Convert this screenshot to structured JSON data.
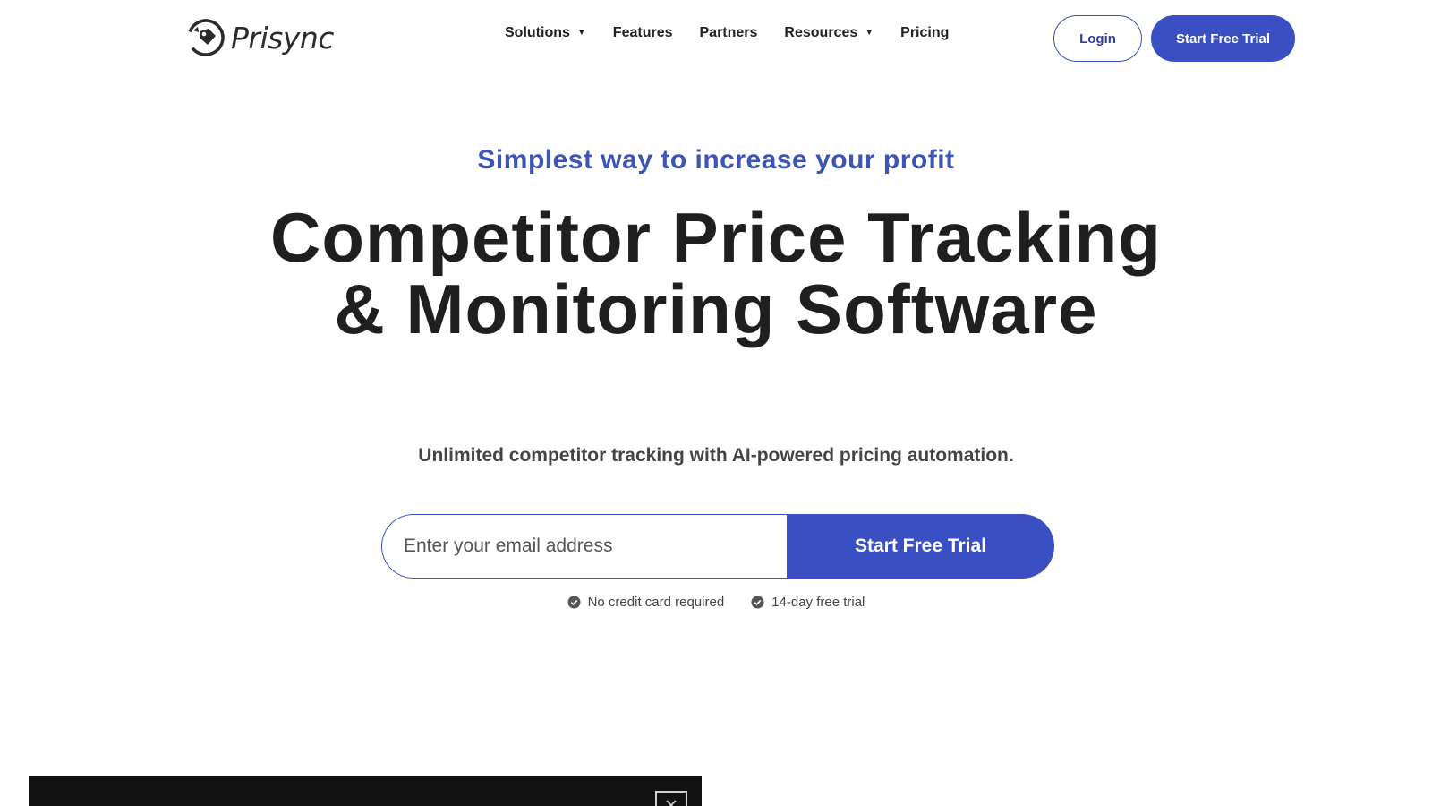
{
  "brand": {
    "name": "Prisync",
    "logo_icon": "price-tag-sync-icon"
  },
  "nav": {
    "items": [
      {
        "label": "Solutions",
        "has_dropdown": true
      },
      {
        "label": "Features",
        "has_dropdown": false
      },
      {
        "label": "Partners",
        "has_dropdown": false
      },
      {
        "label": "Resources",
        "has_dropdown": true
      },
      {
        "label": "Pricing",
        "has_dropdown": false
      }
    ],
    "dropdown_glyph": "▼",
    "login_label": "Login",
    "trial_label": "Start Free Trial"
  },
  "hero": {
    "tagline": "Simplest way to increase your profit",
    "headline": "Competitor Price Tracking & Monitoring Software",
    "subline": "Unlimited competitor tracking with AI-powered pricing automation.",
    "email_placeholder": "Enter your email address",
    "cta_label": "Start Free Trial",
    "perks": [
      "No credit card required",
      "14-day free trial"
    ]
  },
  "colors": {
    "accent": "#3a4fc1",
    "tagline": "#3d55b5",
    "text": "#1f1f1f",
    "overlay": "#111111"
  }
}
